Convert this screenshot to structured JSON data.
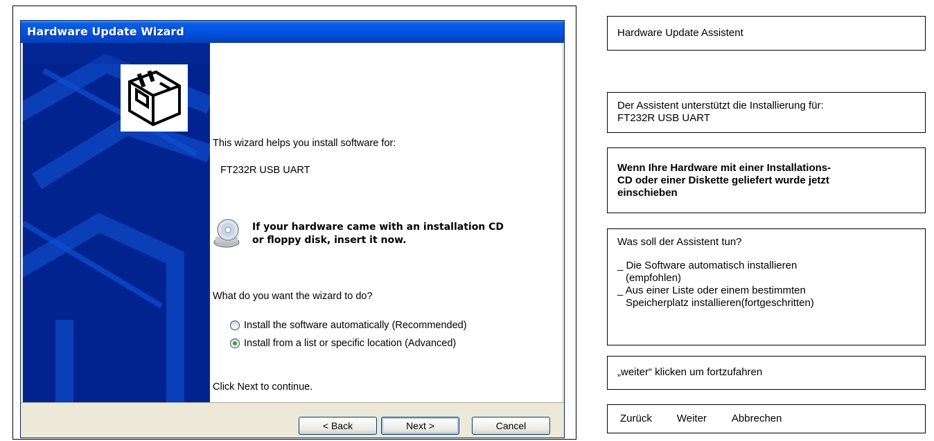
{
  "window": {
    "title": "Hardware Update Wizard"
  },
  "wizard": {
    "intro": "This wizard helps you install software for:",
    "device": "FT232R USB UART",
    "cd_note_line1": "If your hardware came with an installation CD",
    "cd_note_line2": "or floppy disk, insert it now.",
    "question": "What do you want the wizard to do?",
    "options": [
      {
        "label": "Install the software automatically (Recommended)",
        "checked": false
      },
      {
        "label": "Install from a list or specific location (Advanced)",
        "checked": true
      }
    ],
    "continue_text": "Click Next to continue.",
    "buttons": {
      "back": "< Back",
      "next": "Next >",
      "cancel": "Cancel"
    }
  },
  "translation": {
    "title": "Hardware Update Assistent",
    "intro_line1": "Der Assistent unterstützt die Installierung für:",
    "intro_line2": "FT232R USB UART",
    "cd_line1": "Wenn Ihre Hardware mit einer Installations-",
    "cd_line2": "CD oder einer Diskette geliefert wurde jetzt",
    "cd_line3": "einschieben",
    "question": "Was soll der Assistent tun?",
    "option1_line1": "_ Die Software automatisch installieren",
    "option1_line2": "(empfohlen)",
    "option2_line1": "_ Aus einer Liste oder einem bestimmten",
    "option2_line2": "Speicherplatz installieren(fortgeschritten)",
    "continue": "„weiter“ klicken um fortzufahren",
    "nav_back": "Zurück",
    "nav_next": "Weiter",
    "nav_cancel": "Abbrechen"
  },
  "colors": {
    "titlebar": "#0054e3",
    "left_panel": "#00238f",
    "dialog_face": "#ece9d8"
  },
  "icons": {
    "hardware": "hardware-card-icon",
    "cd": "cd-floppy-icon"
  }
}
